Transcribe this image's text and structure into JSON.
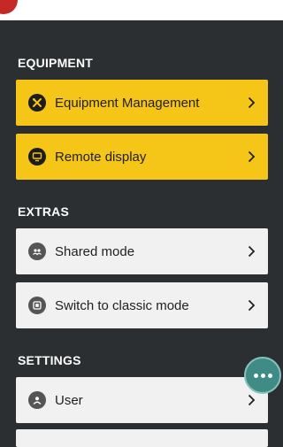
{
  "sections": {
    "equipment": {
      "title": "EQUIPMENT",
      "items": [
        {
          "label": "Equipment Management",
          "icon": "tools-icon"
        },
        {
          "label": "Remote display",
          "icon": "monitor-icon"
        }
      ]
    },
    "extras": {
      "title": "EXTRAS",
      "items": [
        {
          "label": "Shared mode",
          "icon": "shared-users-icon"
        },
        {
          "label": "Switch to classic mode",
          "icon": "classic-mode-icon"
        }
      ]
    },
    "settings": {
      "title": "SETTINGS",
      "items": [
        {
          "label": "User",
          "icon": "user-icon"
        }
      ]
    }
  },
  "colors": {
    "background": "#2b2f31",
    "accent_yellow": "#f5c518",
    "light_button": "#f1f1f1",
    "fab": "#3f8b85"
  },
  "fab": {
    "icon": "more-dots-icon"
  }
}
